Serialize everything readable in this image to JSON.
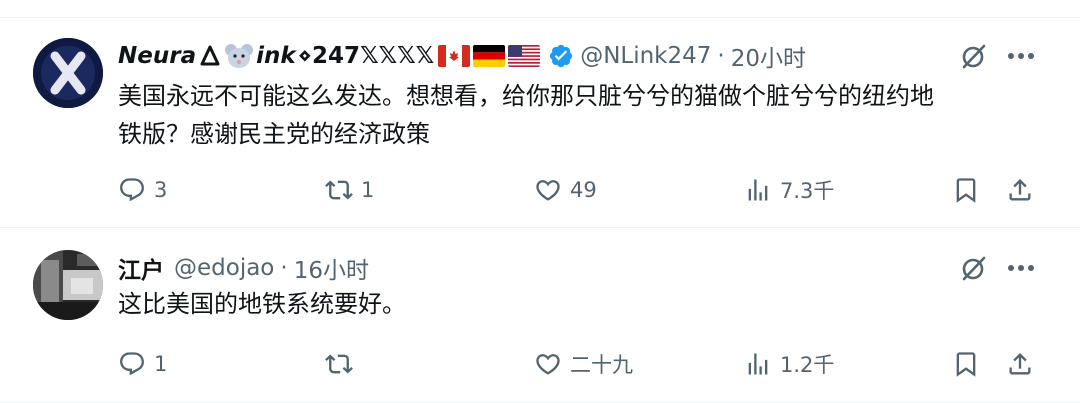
{
  "tweets": [
    {
      "display_name_prefix": "Neura",
      "display_name_mid": "ink",
      "display_name_suffix": "⋄247𝕏𝕏𝕏𝕏",
      "handle": "@NLink247",
      "separator": "·",
      "time": "20小时",
      "body_line1": "美国永远不可能这么发达。想想看，给你那只脏兮兮的猫做个脏兮兮的纽约地",
      "body_line2": "铁版？感谢民主党的经济政策",
      "replies": "3",
      "reposts": "1",
      "likes": "49",
      "views": "7.3千",
      "verified": true,
      "flags": [
        "canada-flag",
        "germany-flag",
        "us-flag"
      ],
      "avatar_colors": {
        "bg": "#0e1a42",
        "mark": "#e8e8f2"
      }
    },
    {
      "display_name": "江户",
      "handle": "@edojao",
      "separator": "·",
      "time": "16小时",
      "body_line1": "这比美国的地铁系统要好。",
      "replies": "1",
      "reposts": "",
      "likes": "二十九",
      "views": "1.2千",
      "verified": false
    }
  ],
  "colors": {
    "text_primary": "#0f1419",
    "text_secondary": "#536471",
    "verified_blue": "#1d9bf0",
    "divider": "#eff3f4"
  }
}
